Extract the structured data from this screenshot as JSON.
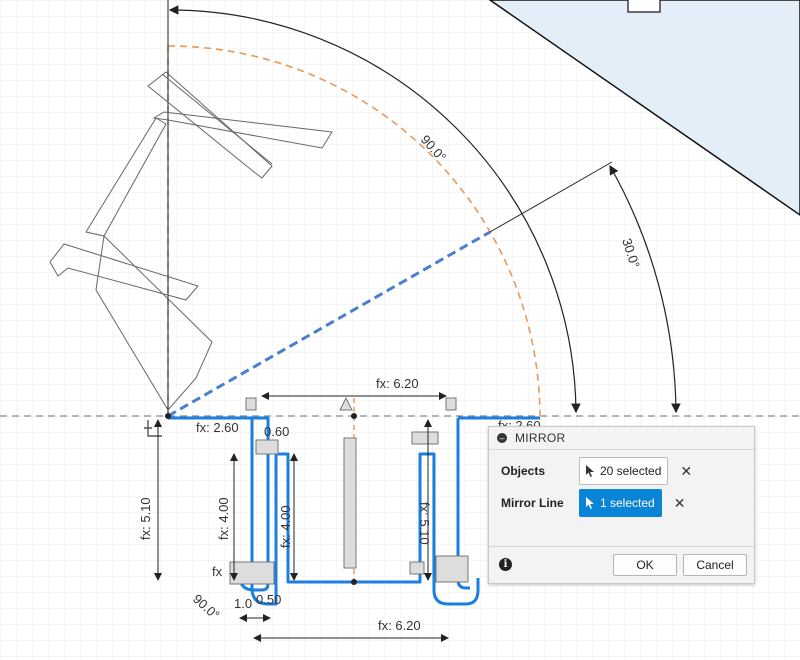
{
  "dimensions": {
    "angle_90_top": "90.0°",
    "angle_30": "30.0°",
    "fx_620_top": "fx: 6.20",
    "fx_260_left": "fx: 2.60",
    "fx_260_right": "fx: 2.60",
    "val_060": "0.60",
    "fx_510_left": "fx: 5.10",
    "fx_400_outer": "fx: 4.00",
    "fx_400_inner": "fx: 4.00",
    "fx_510_right": "fx: 5.10",
    "fx_bottom_left": "fx",
    "angle_90_bottom": "90.0°",
    "val_050": "0.50",
    "val_10": "1.0",
    "fx_620_bottom": "fx: 6.20"
  },
  "mirror_dialog": {
    "title": "MIRROR",
    "objects_label": "Objects",
    "objects_value": "20 selected",
    "mirror_line_label": "Mirror Line",
    "mirror_line_value": "1 selected",
    "ok_label": "OK",
    "cancel_label": "Cancel"
  },
  "icons": {
    "collapse": "minus-circle-icon",
    "cursor": "cursor-arrow-icon",
    "clear": "close-icon",
    "info": "info-icon"
  },
  "colors": {
    "selection_blue": "#0a84d6",
    "construction_orange": "#e89a5a",
    "plane_fill": "#e4eef9"
  }
}
